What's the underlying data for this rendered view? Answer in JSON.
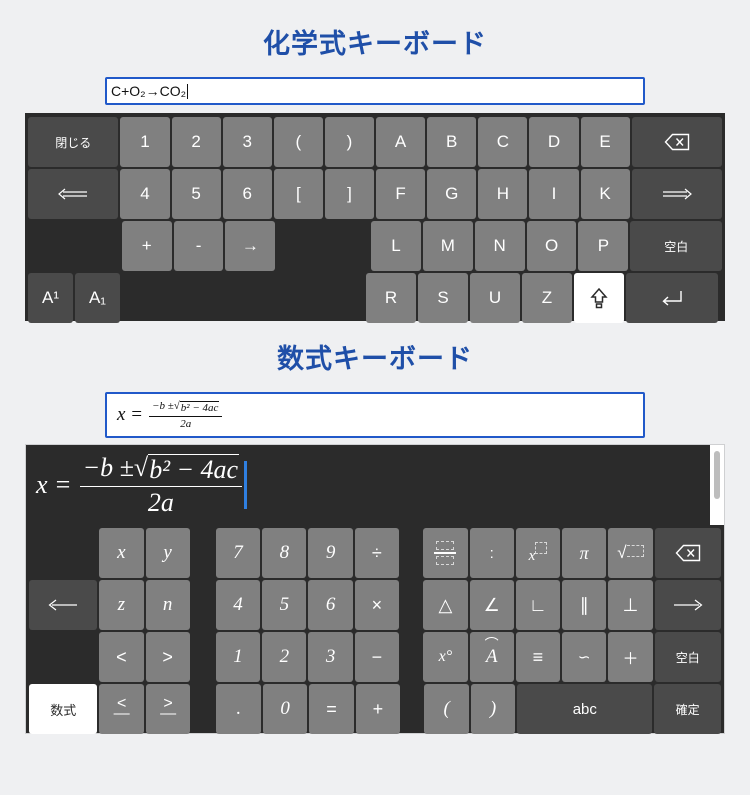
{
  "chem": {
    "title": "化学式キーボード",
    "input_value": "C+O₂→CO₂",
    "keys": {
      "close": "閉じる",
      "space": "空白",
      "row1": [
        "1",
        "2",
        "3",
        "(",
        ")",
        "A",
        "B",
        "C",
        "D",
        "E"
      ],
      "row2": [
        "4",
        "5",
        "6",
        "[",
        "]",
        "F",
        "G",
        "H",
        "I",
        "K"
      ],
      "row3_ops": [
        "+",
        "-",
        "→"
      ],
      "row3_letters": [
        "L",
        "M",
        "N",
        "O",
        "P"
      ],
      "row4_letters": [
        "R",
        "S",
        "U",
        "Z"
      ],
      "superscript": "A¹",
      "subscript": "A₁",
      "backspace_icon": "backspace-icon",
      "left_arrow_icon": "arrow-left-icon",
      "right_arrow_icon": "arrow-right-icon",
      "shift_icon": "shift-icon",
      "enter_icon": "enter-icon"
    }
  },
  "math": {
    "title": "数式キーボード",
    "input_formula": {
      "lhs": "x =",
      "numerator_lead": "−b ±",
      "radicand": "b² − 4ac",
      "denominator": "2a"
    },
    "keys": {
      "mode": "数式",
      "space": "空白",
      "confirm": "確定",
      "abc": "abc",
      "vars_row1": [
        "x",
        "y"
      ],
      "vars_row2": [
        "z",
        "n"
      ],
      "vars_row3": [
        "<",
        ">"
      ],
      "vars_row4": [
        "≦",
        "≧"
      ],
      "num_row1": [
        "7",
        "8",
        "9",
        "÷"
      ],
      "num_row2": [
        "4",
        "5",
        "6",
        "×"
      ],
      "num_row3": [
        "1",
        "2",
        "3",
        "−"
      ],
      "num_row4": [
        ".",
        "0",
        "=",
        "+"
      ],
      "sym_row1": [
        "fraction-template",
        ":",
        "superscript-template",
        "π",
        "sqrt-template"
      ],
      "sym_row2": [
        "△",
        "∠",
        "∟",
        "∥",
        "⊥"
      ],
      "sym_row3": [
        "x°",
        "Â",
        "≡",
        "∽",
        "＋"
      ],
      "sym_row4": [
        "(",
        ")"
      ],
      "backspace_icon": "backspace-icon",
      "left_arrow_icon": "arrow-left-icon",
      "right_arrow_icon": "arrow-right-icon"
    }
  }
}
